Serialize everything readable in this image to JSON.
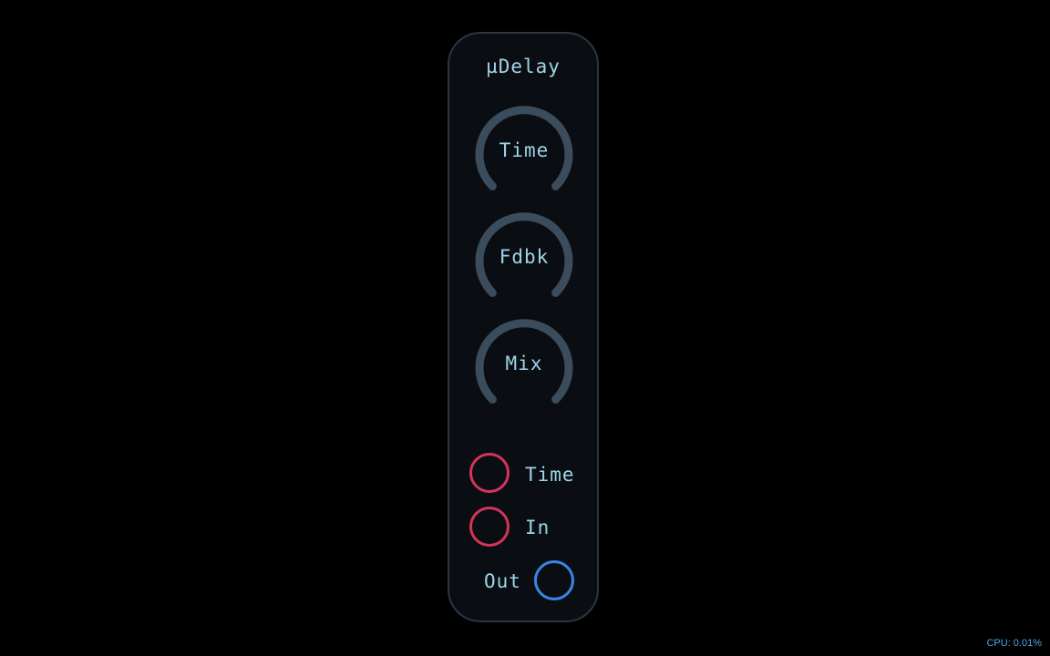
{
  "module": {
    "title": "µDelay",
    "knobs": [
      {
        "label": "Time"
      },
      {
        "label": "Fdbk"
      },
      {
        "label": "Mix"
      }
    ],
    "inputs": [
      {
        "label": "Time"
      },
      {
        "label": "In"
      }
    ],
    "outputs": [
      {
        "label": "Out"
      }
    ]
  },
  "status": {
    "cpu": "CPU: 0.01%"
  },
  "colors": {
    "background": "#000000",
    "panel": "#0a0e12",
    "panel_border": "#2a3642",
    "text": "#9fd3e8",
    "knob_arc": "#3b4d5c",
    "input_jack": "#d6335a",
    "output_jack": "#3a86e6",
    "cpu_text": "#4aa8e8"
  }
}
